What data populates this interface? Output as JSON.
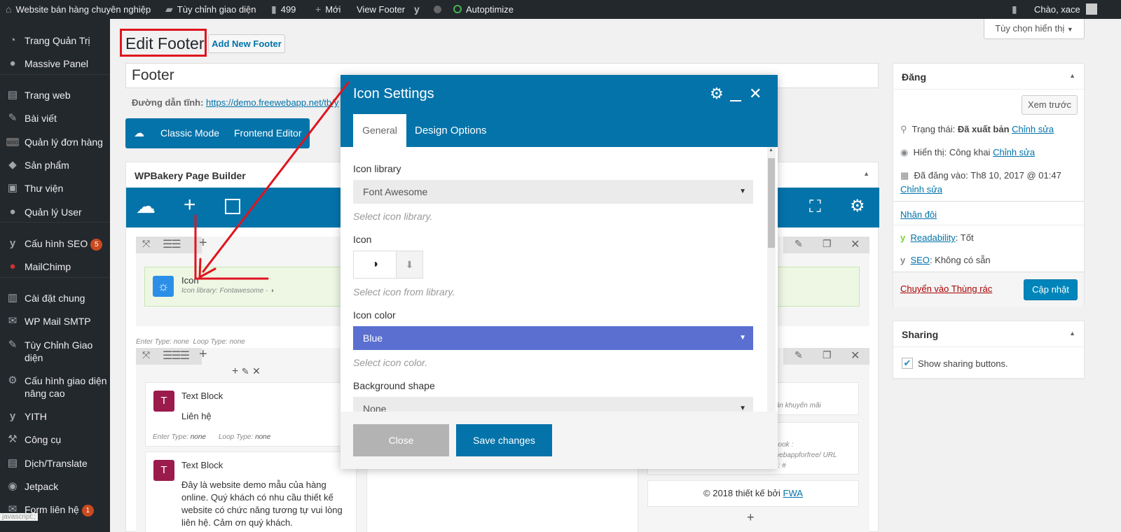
{
  "adminbar": {
    "site_name": "Website bán hàng chuyên nghiệp",
    "customize": "Tùy chỉnh giao diện",
    "comments": "499",
    "new": "Mới",
    "view": "View Footer",
    "autoptimize": "Autoptimize",
    "greeting": "Chào, xace"
  },
  "sidebar": {
    "items": [
      {
        "label": "Trang Quản Trị",
        "icon": "dashboard-icon"
      },
      {
        "label": "Massive Panel",
        "icon": "lightbulb-icon"
      },
      {
        "label": "Trang web",
        "icon": "pages-icon"
      },
      {
        "label": "Bài viết",
        "icon": "pin-icon"
      },
      {
        "label": "Quản lý đơn hàng",
        "icon": "woo-icon"
      },
      {
        "label": "Sản phẩm",
        "icon": "box-icon"
      },
      {
        "label": "Thư viện",
        "icon": "media-icon"
      },
      {
        "label": "Quản lý User",
        "icon": "user-icon"
      },
      {
        "label": "Cấu hình SEO",
        "icon": "yoast-icon",
        "badge": "5"
      },
      {
        "label": "MailChimp",
        "icon": "mailchimp-icon"
      },
      {
        "label": "Cài đặt chung",
        "icon": "settings-icon"
      },
      {
        "label": "WP Mail SMTP",
        "icon": "mail-icon"
      },
      {
        "label": "Tùy Chỉnh Giao diện",
        "icon": "brush-icon"
      },
      {
        "label": "Cấu hình giao diện nâng cao",
        "icon": "gear-icon"
      },
      {
        "label": "YITH",
        "icon": "yith-icon"
      },
      {
        "label": "Công cụ",
        "icon": "wrench-icon"
      },
      {
        "label": "Dịch/Translate",
        "icon": "translate-icon"
      },
      {
        "label": "Jetpack",
        "icon": "jetpack-icon"
      },
      {
        "label": "Form liên hệ",
        "icon": "form-icon",
        "badge": "1"
      }
    ],
    "status_text": "javascript:;"
  },
  "page": {
    "screen_options": "Tùy chọn hiển thị",
    "title": "Edit Footer",
    "add_new": "Add New Footer",
    "post_title": "Footer",
    "permalink_label": "Đường dẫn tĩnh:",
    "permalink_url": "https://demo.freewebapp.net/tb/y",
    "classic_mode": "Classic Mode",
    "frontend_editor": "Frontend Editor",
    "builder_title": "WPBakery Page Builder"
  },
  "builder": {
    "icon_el_title": "Icon",
    "icon_el_sub": "Icon library: Fontawesome - ◑",
    "row_meta": "Enter Type: none  Loop Type: none",
    "text_block": "Text Block",
    "text1": "Liên hệ",
    "enter_type_label": "Enter Type:",
    "enter_type_value": "none",
    "loop_type_label": "Loop Type:",
    "loop_type_value": "none",
    "text2": "Đây là website demo mẫu của hàng online. Quý khách có nhu cầu thiết kế website có chức năng tương tự vui lòng liên hệ. Cảm ơn quý khách.",
    "right_snip1": "ăn khuyến mãi",
    "right_snip2": "book :",
    "right_snip3": "webappforfree/  URL",
    "right_snip4": "n: #",
    "copyright": "© 2018 thiết kế bởi",
    "copyright_link": "FWA"
  },
  "publish": {
    "title": "Đăng",
    "preview": "Xem trước",
    "status_label": "Trạng thái:",
    "status_value": "Đã xuất bản",
    "visibility_label": "Hiển thị:",
    "visibility_value": "Công khai",
    "edit": "Chỉnh sửa",
    "published_label": "Đã đăng vào:",
    "published_value": "Th8 10, 2017 @ 01:47",
    "duplicate": "Nhân đôi",
    "readability_label": "Readability",
    "readability_value": ": Tốt",
    "seo_label": "SEO",
    "seo_value": ": Không có sẵn",
    "trash": "Chuyển vào Thùng rác",
    "update": "Cập nhật"
  },
  "sharing": {
    "title": "Sharing",
    "show": "Show sharing buttons."
  },
  "modal": {
    "title": "Icon Settings",
    "tabs": [
      "General",
      "Design Options"
    ],
    "icon_library_label": "Icon library",
    "icon_library_value": "Font Awesome",
    "icon_library_help": "Select icon library.",
    "icon_label": "Icon",
    "icon_help": "Select icon from library.",
    "icon_color_label": "Icon color",
    "icon_color_value": "Blue",
    "icon_color_help": "Select icon color.",
    "bg_shape_label": "Background shape",
    "bg_shape_value": "None",
    "close": "Close",
    "save": "Save changes"
  },
  "colors": {
    "wp_blue": "#0073aa",
    "modal_blue": "#0473aa",
    "select_blue": "#5a6fd0",
    "annotation_red": "#e0141e"
  }
}
